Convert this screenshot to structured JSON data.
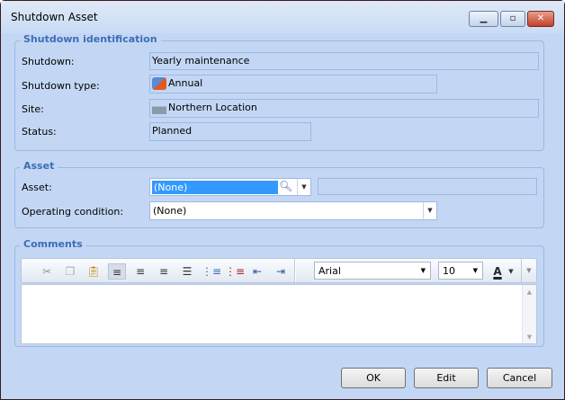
{
  "window": {
    "title": "Shutdown Asset",
    "minimize": "▁",
    "maximize": "▫",
    "close": "✕"
  },
  "identification": {
    "legend": "Shutdown identification",
    "shutdown_label": "Shutdown:",
    "shutdown_value": "Yearly maintenance",
    "type_label": "Shutdown type:",
    "type_value": "Annual",
    "type_icon": "calendar-clock-icon",
    "site_label": "Site:",
    "site_value": "Northern Location",
    "site_icon": "building-icon",
    "status_label": "Status:",
    "status_value": "Planned"
  },
  "asset": {
    "legend": "Asset",
    "asset_label": "Asset:",
    "asset_value": "(None)",
    "asset_description": "",
    "condition_label": "Operating condition:",
    "condition_value": "(None)"
  },
  "comments": {
    "legend": "Comments",
    "font": "Arial",
    "size": "10",
    "text": ""
  },
  "buttons": {
    "ok": "OK",
    "edit": "Edit",
    "cancel": "Cancel"
  }
}
